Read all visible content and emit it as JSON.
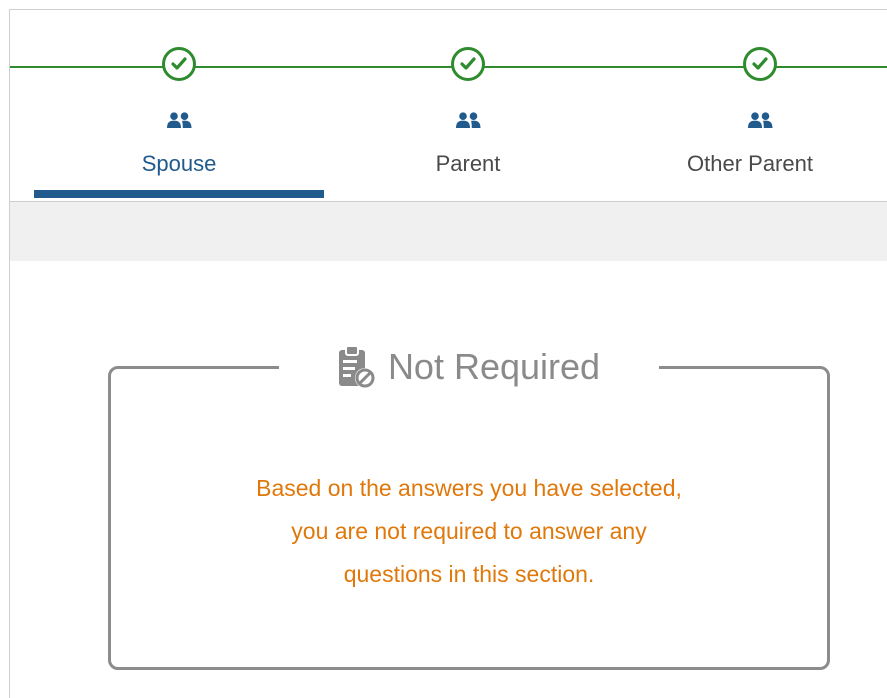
{
  "colors": {
    "complete_green": "#2e8b2e",
    "active_blue": "#215a8c",
    "muted_gray": "#8a8a8a",
    "notice_orange": "#e0780b"
  },
  "steps": [
    {
      "label": "Spouse",
      "status": "complete",
      "active": true,
      "icon": "people-icon"
    },
    {
      "label": "Parent",
      "status": "complete",
      "active": false,
      "icon": "people-icon"
    },
    {
      "label": "Other Parent",
      "status": "complete",
      "active": false,
      "icon": "people-icon"
    }
  ],
  "notice": {
    "icon": "document-blocked-icon",
    "title": "Not Required",
    "lines": [
      "Based on the answers you have selected,",
      "you are not required to answer any",
      "questions in this section."
    ]
  }
}
